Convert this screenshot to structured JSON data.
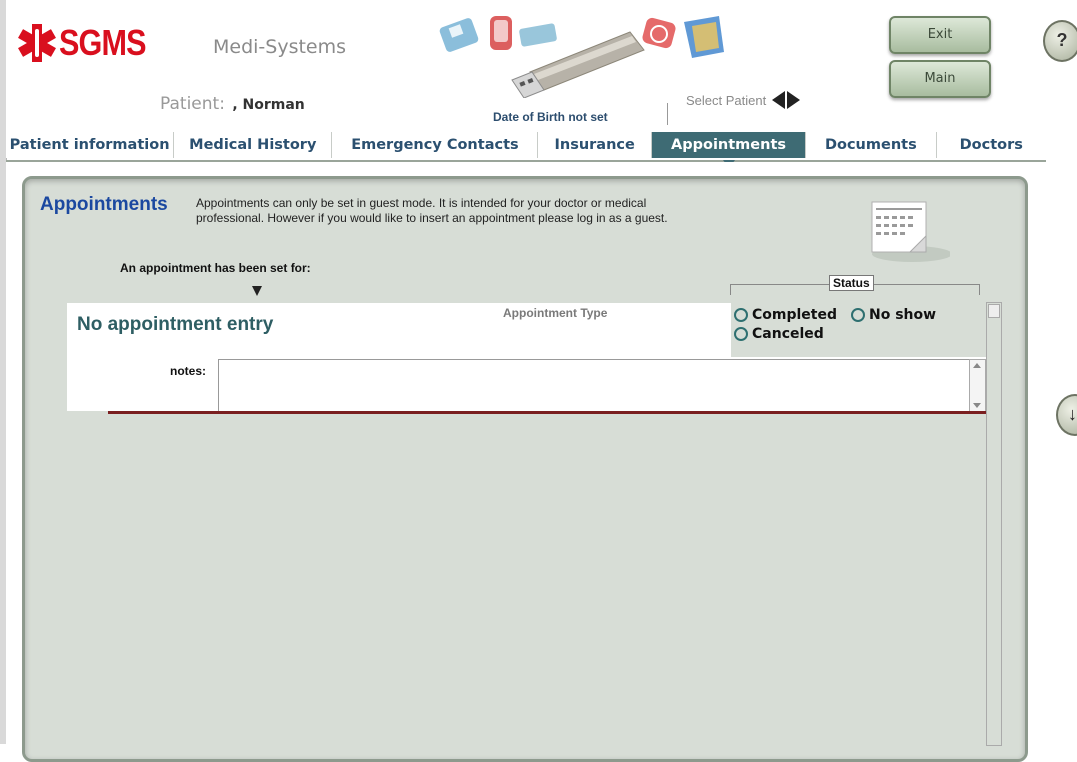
{
  "header": {
    "logo_text": "SGMS",
    "company": "Medi-Systems",
    "patient_label": "Patient:",
    "patient_name": ", Norman",
    "dob": "Date of Birth not set",
    "select_patient": "Select Patient",
    "exit_label": "Exit",
    "main_label": "Main",
    "help_label": "?"
  },
  "tabs": [
    {
      "label": "Patient information"
    },
    {
      "label": "Medical History"
    },
    {
      "label": "Emergency Contacts"
    },
    {
      "label": "Insurance"
    },
    {
      "label": "Appointments",
      "active": true
    },
    {
      "label": "Documents"
    },
    {
      "label": "Doctors"
    }
  ],
  "appointments": {
    "title": "Appointments",
    "description": "Appointments can only be set in guest mode.  It is intended for your doctor or medical professional.  However if you would like to insert an appointment please log in as a guest.",
    "set_for_label": "An appointment has been set for:",
    "status_label": "Status",
    "entry_text": "No appointment entry",
    "appointment_type_label": "Appointment Type",
    "status_options": [
      "Completed",
      "No show",
      "Canceled"
    ],
    "notes_label": "notes:",
    "notes_value": ""
  },
  "colors": {
    "brand_red": "#d90f1e",
    "tab_active": "#3e6b74",
    "tab_text": "#2b5070",
    "panel_bg": "#d7ddd6",
    "title_blue": "#1b48a0",
    "divider": "#7a1f20"
  }
}
